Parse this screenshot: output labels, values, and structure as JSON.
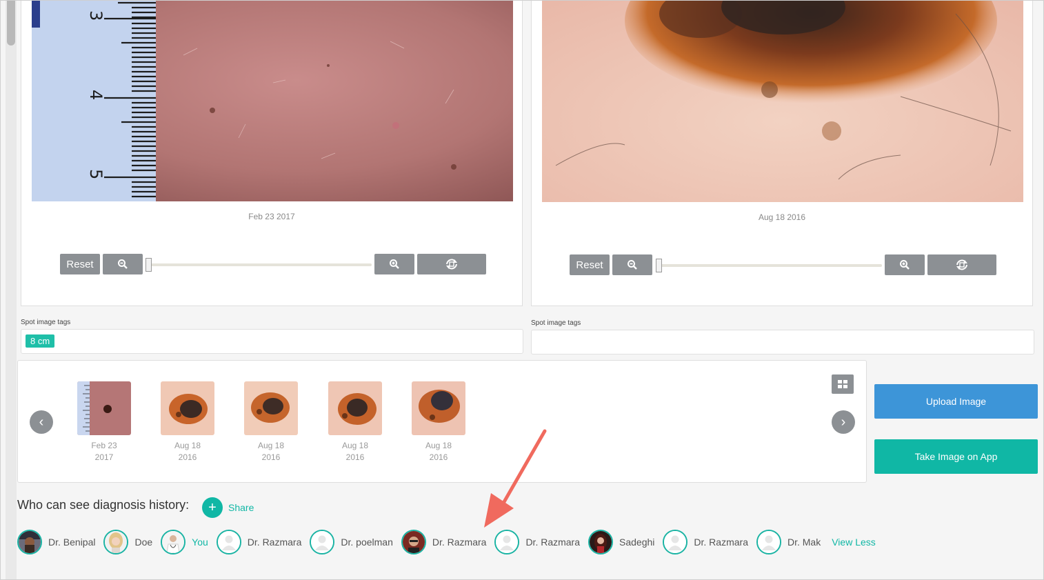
{
  "panels": [
    {
      "date": "Feb 23 2017",
      "ruler_numbers": [
        "3",
        "4",
        "5"
      ],
      "controls": {
        "reset": "Reset",
        "zoom_out_icon": "zoom-out-icon",
        "zoom_in_icon": "zoom-in-icon",
        "rotate_icon": "rotate-icon"
      },
      "zoom_level": 0,
      "tags_label": "Spot image tags",
      "tags": [
        "8 cm"
      ]
    },
    {
      "date": "Aug 18 2016",
      "controls": {
        "reset": "Reset",
        "zoom_out_icon": "zoom-out-icon",
        "zoom_in_icon": "zoom-in-icon",
        "rotate_icon": "rotate-icon"
      },
      "zoom_level": 0,
      "tags_label": "Spot image tags",
      "tags": []
    }
  ],
  "gallery": {
    "prev_icon": "‹",
    "next_icon": "›",
    "grid_icon": "grid-view-icon",
    "thumbs": [
      {
        "date_line1": "Feb 23",
        "date_line2": "2017",
        "kind": "clinical"
      },
      {
        "date_line1": "Aug 18",
        "date_line2": "2016",
        "kind": "dermoscopy"
      },
      {
        "date_line1": "Aug 18",
        "date_line2": "2016",
        "kind": "dermoscopy"
      },
      {
        "date_line1": "Aug 18",
        "date_line2": "2016",
        "kind": "dermoscopy"
      },
      {
        "date_line1": "Aug 18",
        "date_line2": "2016",
        "kind": "dermoscopy"
      }
    ]
  },
  "actions": {
    "upload_label": "Upload Image",
    "take_label": "Take Image on App"
  },
  "sharing": {
    "title": "Who can see diagnosis history:",
    "share_label": "Share",
    "share_icon": "+",
    "people": [
      {
        "name": "Dr. Benipal",
        "avatar": "photo-turban"
      },
      {
        "name": "Doe",
        "avatar": "photo-blonde"
      },
      {
        "name": "You",
        "avatar": "photo-doctor"
      },
      {
        "name": "Dr. Razmara",
        "avatar": "placeholder"
      },
      {
        "name": "Dr. poelman",
        "avatar": "placeholder"
      },
      {
        "name": "Dr. Razmara",
        "avatar": "photo-man"
      },
      {
        "name": "Dr. Razmara",
        "avatar": "placeholder"
      },
      {
        "name": "Sadeghi",
        "avatar": "photo-woman"
      },
      {
        "name": "Dr. Razmara",
        "avatar": "placeholder"
      },
      {
        "name": "Dr. Mak",
        "avatar": "placeholder"
      }
    ],
    "view_less_label": "View Less"
  },
  "colors": {
    "accent_teal": "#10b7a5",
    "upload_blue": "#3d95d8",
    "control_gray": "#8c9094",
    "annotation_arrow": "#f06a5e"
  }
}
